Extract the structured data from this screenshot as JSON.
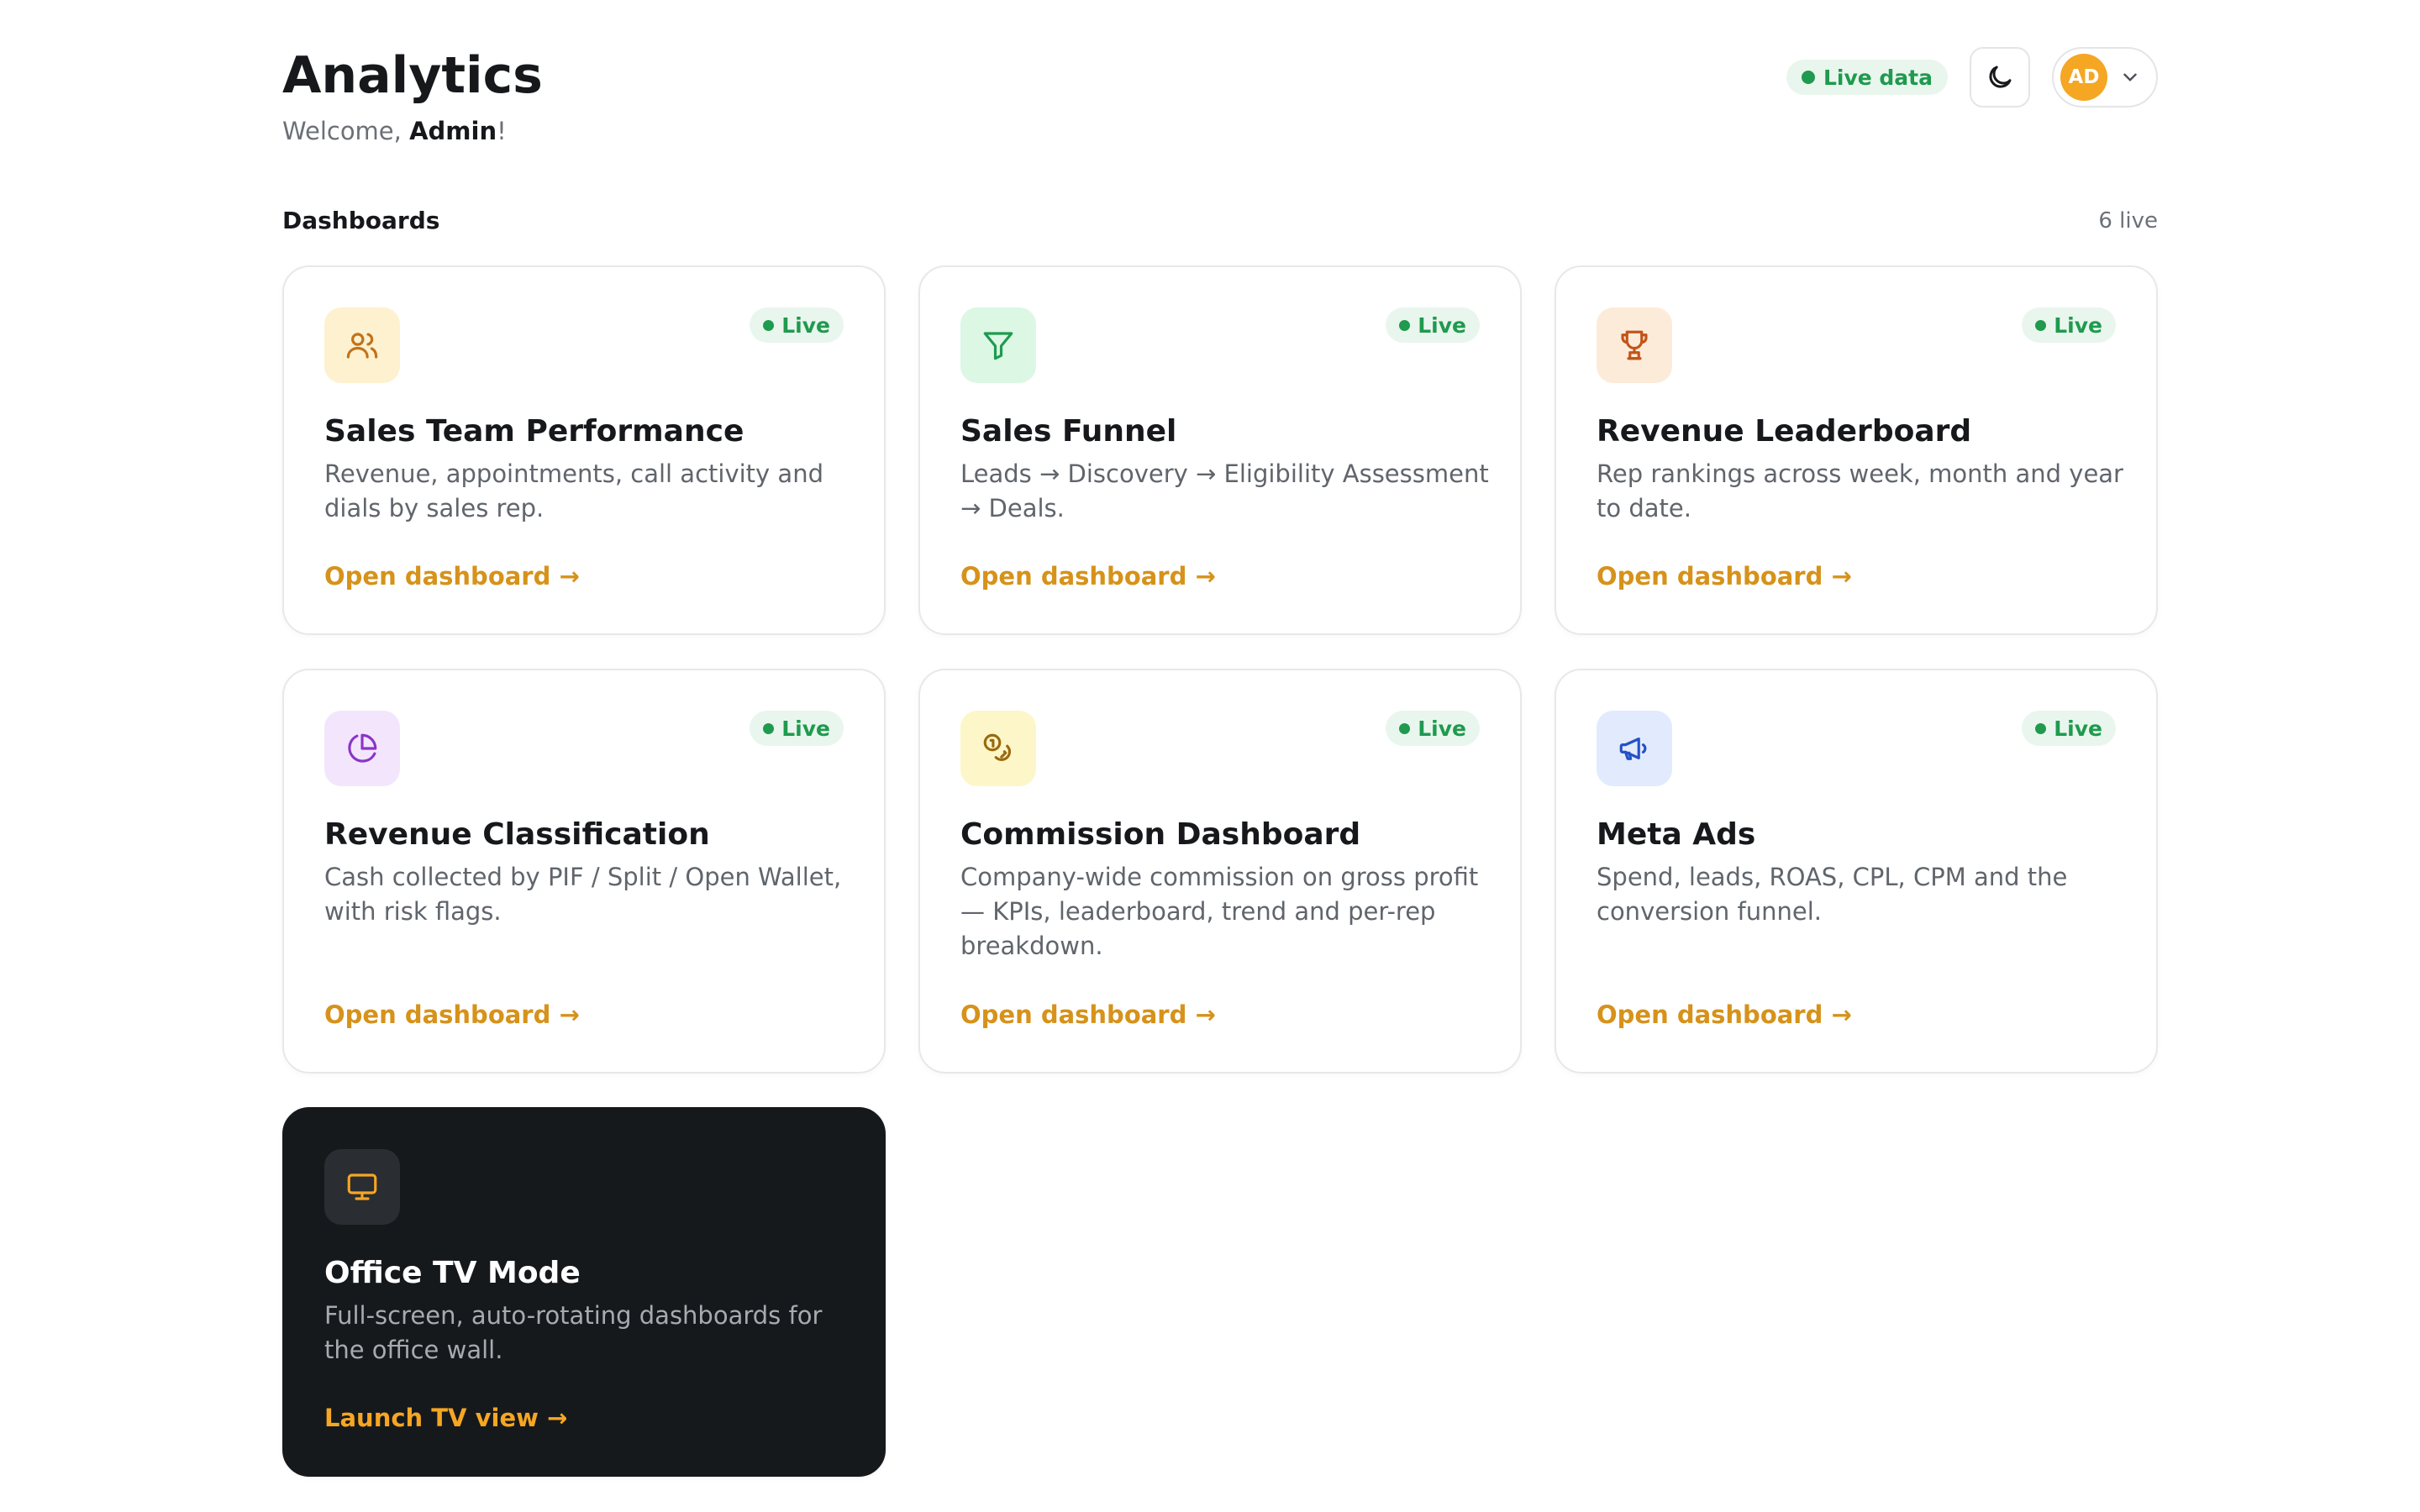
{
  "header": {
    "title": "Analytics",
    "welcome_prefix": "Welcome, ",
    "user_name": "Admin",
    "welcome_suffix": "!",
    "live_label": "Live data",
    "avatar_initials": "AD"
  },
  "section": {
    "title": "Dashboards",
    "count": "6 live"
  },
  "cards": [
    {
      "title": "Sales Team Performance",
      "description": "Revenue, appointments, call activity and dials by sales rep.",
      "badge": "Live",
      "link": "Open dashboard →",
      "icon": "users-icon",
      "icon_bg": "#fdf1cf",
      "icon_color": "#c1721b"
    },
    {
      "title": "Sales Funnel",
      "description": "Leads → Discovery → Eligibility Assessment → Deals.",
      "badge": "Live",
      "link": "Open dashboard →",
      "icon": "funnel-icon",
      "icon_bg": "#dcf7e4",
      "icon_color": "#1e9a4f"
    },
    {
      "title": "Revenue Leaderboard",
      "description": "Rep rankings across week, month and year to date.",
      "badge": "Live",
      "link": "Open dashboard →",
      "icon": "trophy-icon",
      "icon_bg": "#fdebd9",
      "icon_color": "#c2541a"
    },
    {
      "title": "Revenue Classification",
      "description": "Cash collected by PIF / Split / Open Wallet, with risk flags.",
      "badge": "Live",
      "link": "Open dashboard →",
      "icon": "pie-chart-icon",
      "icon_bg": "#f3e6fc",
      "icon_color": "#8a34c9"
    },
    {
      "title": "Commission Dashboard",
      "description": "Company-wide commission on gross profit — KPIs, leaderboard, trend and per-rep breakdown.",
      "badge": "Live",
      "link": "Open dashboard →",
      "icon": "coins-icon",
      "icon_bg": "#fdf6c8",
      "icon_color": "#9a6a10"
    },
    {
      "title": "Meta Ads",
      "description": "Spend, leads, ROAS, CPL, CPM and the conversion funnel.",
      "badge": "Live",
      "link": "Open dashboard →",
      "icon": "megaphone-icon",
      "icon_bg": "#e1ebfd",
      "icon_color": "#2550c8"
    },
    {
      "title": "Office TV Mode",
      "description": "Full-screen, auto-rotating dashboards for the office wall.",
      "link": "Launch TV view →",
      "icon": "monitor-icon",
      "icon_bg": "#2a2d31",
      "icon_color": "#f5a623"
    }
  ],
  "colors": {
    "accent": "#d6921a",
    "live_green": "#1f9a4e",
    "live_bg": "#e9f6ee",
    "dark_card": "#16191c"
  }
}
